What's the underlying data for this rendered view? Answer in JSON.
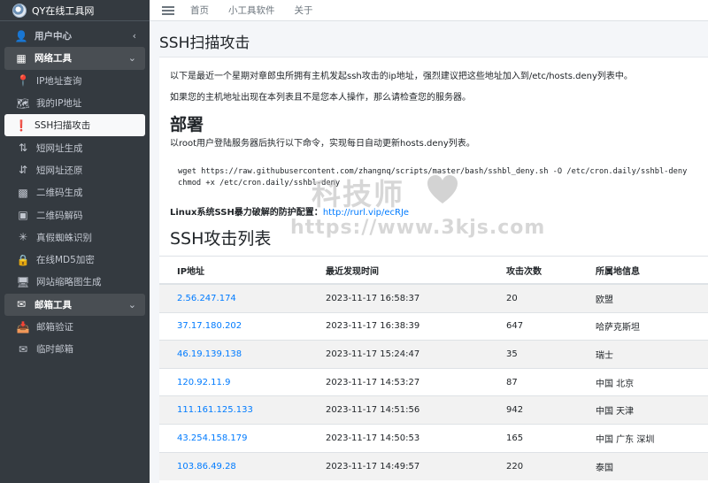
{
  "brand": {
    "title": "QY在线工具网"
  },
  "sidebar": {
    "items": [
      {
        "label": "用户中心",
        "icon": "user-icon",
        "type": "group",
        "caret": "‹"
      },
      {
        "label": "网络工具",
        "icon": "grid-icon",
        "type": "group-open",
        "caret": "⌄"
      },
      {
        "label": "IP地址查询",
        "icon": "map-pin-icon",
        "type": "sub"
      },
      {
        "label": "我的IP地址",
        "icon": "map-icon",
        "type": "sub"
      },
      {
        "label": "SSH扫描攻击",
        "icon": "alert-circle-icon",
        "type": "active"
      },
      {
        "label": "短网址生成",
        "icon": "sort-amount-icon",
        "type": "sub"
      },
      {
        "label": "短网址还原",
        "icon": "sort-reverse-icon",
        "type": "sub"
      },
      {
        "label": "二维码生成",
        "icon": "qrcode-icon",
        "type": "sub"
      },
      {
        "label": "二维码解码",
        "icon": "qrcode-scan-icon",
        "type": "sub"
      },
      {
        "label": "真假蜘蛛识别",
        "icon": "spider-icon",
        "type": "sub"
      },
      {
        "label": "在线MD5加密",
        "icon": "lock-icon",
        "type": "sub"
      },
      {
        "label": "网站缩略图生成",
        "icon": "desktop-icon",
        "type": "sub"
      },
      {
        "label": "邮箱工具",
        "icon": "envelope-icon",
        "type": "group-open",
        "caret": "⌄"
      },
      {
        "label": "邮箱验证",
        "icon": "inbox-check-icon",
        "type": "sub"
      },
      {
        "label": "临时邮箱",
        "icon": "mail-icon",
        "type": "sub"
      }
    ]
  },
  "topnav": {
    "links": [
      "首页",
      "小工具软件",
      "关于"
    ]
  },
  "page": {
    "title": "SSH扫描攻击",
    "intro1": "以下是最近一个星期对章郎虫所拥有主机发起ssh攻击的ip地址，强烈建议把这些地址加入到/etc/hosts.deny列表中。",
    "intro2": "如果您的主机地址出现在本列表且不是您本人操作，那么请检查您的服务器。",
    "deploy_title": "部署",
    "deploy_desc": "以root用户登陆服务器后执行以下命令，实现每日自动更新hosts.deny列表。",
    "command": "wget https://raw.githubusercontent.com/zhangnq/scripts/master/bash/sshbl_deny.sh -O /etc/cron.daily/sshbl-deny\nchmod +x /etc/cron.daily/sshbl-deny",
    "protect_label": "Linux系统SSH暴力破解的防护配置：",
    "protect_link": "http://rurl.vip/ecRJe",
    "list_title": "SSH攻击列表"
  },
  "table": {
    "headers": [
      "IP地址",
      "最近发现时间",
      "攻击次数",
      "所属地信息"
    ],
    "rows": [
      [
        "2.56.247.174",
        "2023-11-17 16:58:37",
        "20",
        "欧盟"
      ],
      [
        "37.17.180.202",
        "2023-11-17 16:38:39",
        "647",
        "哈萨克斯坦"
      ],
      [
        "46.19.139.138",
        "2023-11-17 15:24:47",
        "35",
        "瑞士"
      ],
      [
        "120.92.11.9",
        "2023-11-17 14:53:27",
        "87",
        "中国 北京"
      ],
      [
        "111.161.125.133",
        "2023-11-17 14:51:56",
        "942",
        "中国 天津"
      ],
      [
        "43.254.158.179",
        "2023-11-17 14:50:53",
        "165",
        "中国 广东 深圳"
      ],
      [
        "103.86.49.28",
        "2023-11-17 14:49:57",
        "220",
        "泰国"
      ]
    ]
  },
  "watermark": {
    "title": "科技师",
    "url": "https://www.3kjs.com"
  },
  "colors": {
    "sidebar_bg": "#343a40",
    "link": "#007bff",
    "active_bg": "#f8f9fa"
  }
}
